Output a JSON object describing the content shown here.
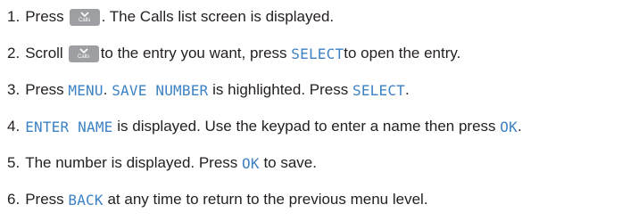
{
  "steps": [
    {
      "num": "1.",
      "a": "Press",
      "key_label": "Calls",
      "b": ". The Calls list screen is displayed."
    },
    {
      "num": "2.",
      "a": "Scroll",
      "key_label": "Calls",
      "b": " to the entry you want, press ",
      "kw1": "SELECT",
      "c": " to open the entry."
    },
    {
      "num": "3.",
      "a": "Press ",
      "kw1": "MENU",
      "b": ". ",
      "kw2": "SAVE NUMBER",
      "c": " is highlighted. Press ",
      "kw3": "SELECT",
      "d": "."
    },
    {
      "num": "4.",
      "kw1": "ENTER NAME",
      "a": " is displayed. Use the keypad to enter a name then press ",
      "kw2": "OK",
      "b": "."
    },
    {
      "num": "5.",
      "a": "The number is displayed. Press ",
      "kw1": "OK",
      "b": " to save."
    },
    {
      "num": "6.",
      "a": "Press ",
      "kw1": "BACK",
      "b": " at any time to return to the previous menu level."
    }
  ],
  "colors": {
    "keyword": "#3d82c4",
    "key_bg": "#9d9fa2",
    "text": "#231f20"
  },
  "icons": {
    "calls_key": "chevron-down-icon"
  }
}
